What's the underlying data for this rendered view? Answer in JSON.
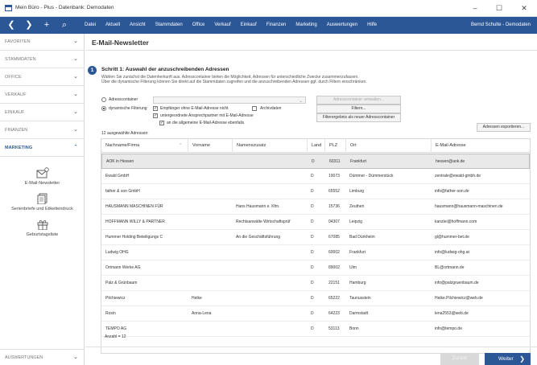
{
  "window": {
    "title": "Mein Büro - Plus - Datenbank: Demodaten",
    "controls": [
      "–",
      "☐",
      "✕"
    ]
  },
  "menubar": {
    "nav": [
      "❮",
      "❯",
      "+",
      "⌕"
    ],
    "items": [
      "Datei",
      "Aktuell",
      "Ansicht",
      "Stammdaten",
      "Office",
      "Verkauf",
      "Einkauf",
      "Finanzen",
      "Marketing",
      "Auswertungen",
      "Hilfe"
    ],
    "user": "Bernd Schulte - Demodaten"
  },
  "sidebar": {
    "sections": [
      "FAVORITEN",
      "STAMMDATEN",
      "OFFICE",
      "VERKAUF",
      "EINKAUF",
      "FINANZEN",
      "MARKETING"
    ],
    "active_section": "MARKETING",
    "items": [
      "E-Mail-Newsletter",
      "Serienbriefe und Etikettendruck",
      "Geburtstagsliste"
    ],
    "bottom_section": "AUSWERTUNGEN",
    "chevron_down": "⌄",
    "chevron_up": "⌃"
  },
  "page": {
    "title": "E-Mail-Newsletter",
    "step_number": "1",
    "step_title": "Schritt 1: Auswahl der anzuschreibenden Adressen",
    "step_desc_1": "Wählen Sie zunächst die Datenherkunft aus. Adresscontainer bieten die Möglichkeit, Adressen für unterschiedliche Zwecke zusammenzufassen.",
    "step_desc_2": "Über die dynamische Filterung können Sie direkt auf die Stammdaten zugreifen und die anzuschreibenden Adressen ggf. durch Filtern einschränken."
  },
  "options": {
    "adresscontainer": "Adresscontainer",
    "dyn_filter": "dynamische Filterung",
    "empfaenger": "Empfänger ohne E-Mail-Adresse nicht",
    "archivdaten": "Archivdaten",
    "untergeordnete": "untergeordnete Ansprechpartner mit E-Mail-Adresse",
    "allgemeine": "an die allgemeine E-Mail-Adresse ebenfalls",
    "checkmark": "✓"
  },
  "buttons": {
    "container_verwalten": "Adresscontainer verwalten...",
    "filtern": "Filtern...",
    "filterergebnis": "Filterergebnis als neuer Adresscontainer",
    "export": "Adressen exportieren...",
    "back": "Zurück",
    "next": "Weiter",
    "next_arrow": "❯"
  },
  "table": {
    "count_label": "12 ausgewählte Adressen:",
    "sort_arrow": "^",
    "headers": [
      "Nachname/Firma",
      "Vorname",
      "Namenszusatz",
      "Land",
      "PLZ",
      "Ort",
      "E-Mail-Adresse"
    ],
    "rows": [
      [
        "AOK in Hessen",
        "",
        "",
        "D",
        "60311",
        "Frankfurt",
        "hessen@aok.de"
      ],
      [
        "Ewald GmbH",
        "",
        "",
        "D",
        "19073",
        "Dümmer - Dümmerstück",
        "zentrale@ewald-gmbh.de"
      ],
      [
        "father & son GmbH",
        "",
        "",
        "D",
        "65552",
        "Limburg",
        "info@father-son.de"
      ],
      [
        "HAUSMANN MASCHINEN FÜR",
        "",
        "Hans Hausmann e. Kfm.",
        "D",
        "15736",
        "Zeuthen",
        "hausmann@hausmann-maschinen.de"
      ],
      [
        "HOFFMANN WILLY & PARTNER",
        "",
        "Rechtsanwälte Wirtschaftsprüf",
        "D",
        "04307",
        "Leipzig",
        "kanzlei@hoffmann.com"
      ],
      [
        "Hummer Holding Beteiligungs C",
        "",
        "An die Geschäftsführung",
        "D",
        "67085",
        "Bad Dürkheim",
        "gl@hummer-bet.de"
      ],
      [
        "Ludwig OHG",
        "",
        "",
        "D",
        "60002",
        "Frankfurt",
        "info@ludwig-ohg.at"
      ],
      [
        "Ortmann Werke AG",
        "",
        "",
        "D",
        "89002",
        "Ulm",
        "BL@ortmann.de"
      ],
      [
        "Palz & Grünbaum",
        "",
        "",
        "D",
        "22151",
        "Hamburg",
        "info@palzgruenbaum.de"
      ],
      [
        "Pilchiewicz",
        "Heike",
        "",
        "D",
        "65222",
        "Taunusstein",
        "Heike.Pilchiewicz@web.de"
      ],
      [
        "Rosin",
        "Anna-Lena",
        "",
        "D",
        "64223",
        "Darmstadt",
        "lena2553@web.de"
      ],
      [
        "TEMPO AG",
        "",
        "",
        "D",
        "53113",
        "Bonn",
        "info@tempo.de"
      ]
    ],
    "total": "Anzahl = 12"
  }
}
